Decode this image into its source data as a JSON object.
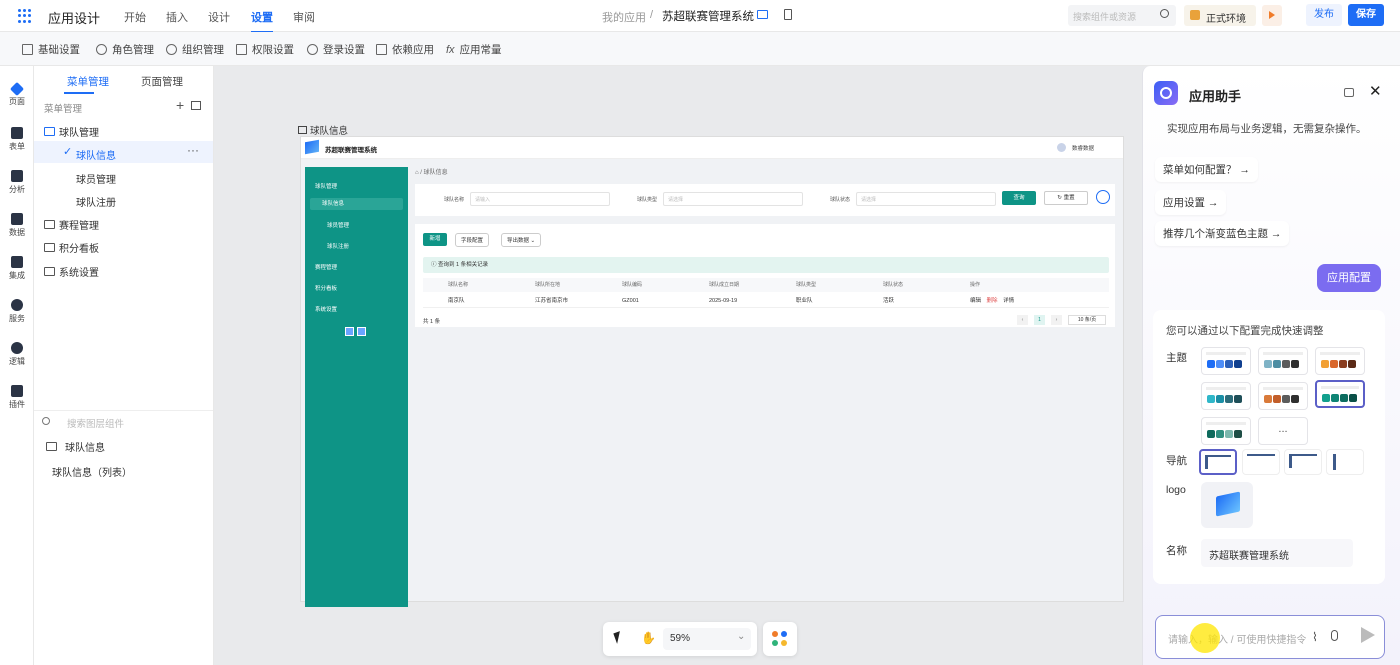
{
  "topbar": {
    "app_title": "应用设计",
    "tabs": [
      "开始",
      "插入",
      "设计",
      "设置",
      "审阅"
    ],
    "active_tab": "设置",
    "breadcrumb_root": "我的应用",
    "breadcrumb_sep": "/",
    "app_name": "苏超联赛管理系统",
    "search_placeholder": "搜索组件或资源",
    "env_label": "正式环境",
    "publish": "发布",
    "save": "保存"
  },
  "subbar": [
    "基础设置",
    "角色管理",
    "组织管理",
    "权限设置",
    "登录设置",
    "依赖应用",
    "应用常量"
  ],
  "rail": [
    "页面",
    "表单",
    "分析",
    "数据",
    "集成",
    "服务",
    "逻辑",
    "插件"
  ],
  "panel": {
    "tabs": [
      "菜单管理",
      "页面管理"
    ],
    "section": "菜单管理",
    "tree": [
      {
        "label": "球队管理",
        "level": 0,
        "folder": true
      },
      {
        "label": "球队信息",
        "level": 1,
        "selected": true
      },
      {
        "label": "球员管理",
        "level": 1
      },
      {
        "label": "球队注册",
        "level": 1
      },
      {
        "label": "赛程管理",
        "level": 0,
        "folder": true
      },
      {
        "label": "积分看板",
        "level": 0,
        "folder": true
      },
      {
        "label": "系统设置",
        "level": 0,
        "folder": true
      }
    ],
    "layer_search_placeholder": "搜索图层组件",
    "layers": [
      "球队信息",
      "球队信息（列表）"
    ]
  },
  "preview": {
    "frame_label": "球队信息",
    "sys_title": "苏超联赛管理系统",
    "user": "数睿数据",
    "crumb": "球队信息",
    "nav": [
      {
        "label": "球队管理",
        "type": "group"
      },
      {
        "label": "球队信息",
        "type": "active"
      },
      {
        "label": "球员管理",
        "type": "sub"
      },
      {
        "label": "球队注册",
        "type": "sub"
      },
      {
        "label": "赛程管理",
        "type": "group"
      },
      {
        "label": "积分看板",
        "type": "group"
      },
      {
        "label": "系统设置",
        "type": "group"
      }
    ],
    "filters": [
      {
        "label": "球队名称",
        "placeholder": "请输入"
      },
      {
        "label": "球队类型",
        "placeholder": "请选择"
      },
      {
        "label": "球队状态",
        "placeholder": "请选择"
      }
    ],
    "query": "查询",
    "reset": "重置",
    "actions": [
      "新增",
      "字段配置",
      "导出数据"
    ],
    "info": "查询到 1 条相关记录",
    "columns": [
      "球队名称",
      "球队所在地",
      "球队编码",
      "球队成立日期",
      "球队类型",
      "球队状态",
      "操作"
    ],
    "rows": [
      [
        "南京队",
        "江苏省南京市",
        "GZ001",
        "2025-09-19",
        "职业队",
        "活跃"
      ]
    ],
    "row_ops": [
      "编辑",
      "删除",
      "详情"
    ],
    "total": "共 1 条",
    "page": "1",
    "page_size": "10 条/页"
  },
  "toolbar": {
    "zoom": "59%"
  },
  "assistant": {
    "title": "应用助手",
    "intro": "实现应用布局与业务逻辑，无需复杂操作。",
    "suggestions": [
      "菜单如何配置？ →",
      "应用设置 →",
      "推荐几个渐变蓝色主题 →"
    ],
    "user_msg": "应用配置",
    "reply_title": "您可以通过以下配置完成快速调整",
    "labels": {
      "theme": "主题",
      "nav": "导航",
      "logo": "logo",
      "name": "名称"
    },
    "themes": [
      [
        "#1e6df5",
        "#4d8df7",
        "#2b5fb8",
        "#0f3f8f"
      ],
      [
        "#7fb3c6",
        "#4d8ea3",
        "#5c5c5c",
        "#2f2f2f"
      ],
      [
        "#f2a033",
        "#d9662b",
        "#8a3d1f",
        "#5b2a16"
      ],
      [
        "#2fb7c9",
        "#1a8fa6",
        "#2c6c7a",
        "#1e4e58"
      ],
      [
        "#d97a3a",
        "#c25e2a",
        "#5c5c5c",
        "#2f2f2f"
      ],
      [
        "#12a08d",
        "#0e8474",
        "#0c6d60",
        "#0a5048"
      ],
      [
        "#0e6a5c",
        "#2f8f80",
        "#7bb7ad",
        "#1e4e46"
      ]
    ],
    "more": "...",
    "name_value": "苏超联赛管理系统",
    "input_placeholder": "请输入，输入 / 可使用快捷指令"
  }
}
